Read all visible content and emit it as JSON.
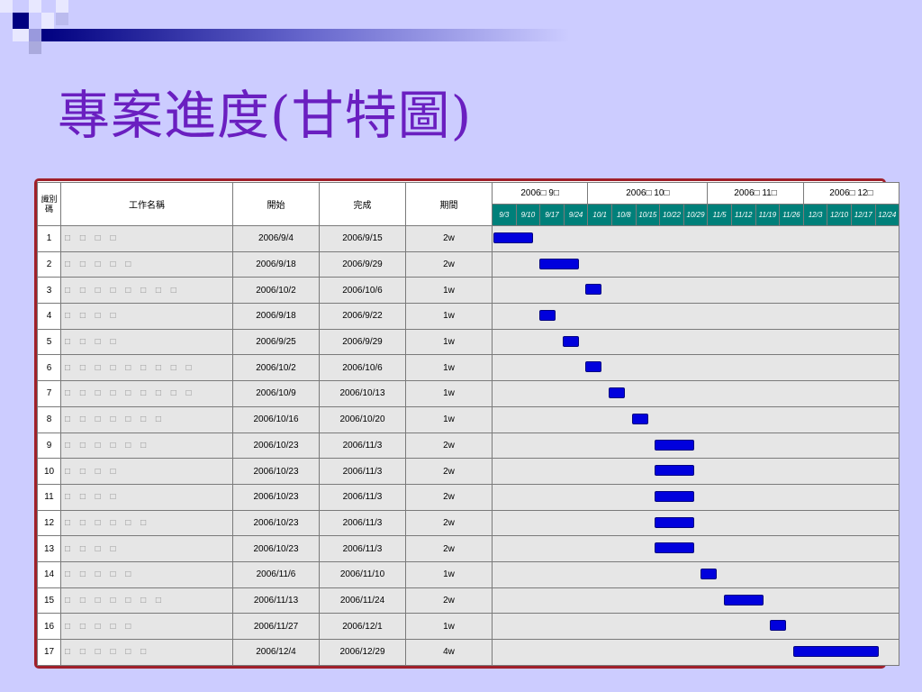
{
  "slide": {
    "title": "專案進度(甘特圖)",
    "colors": {
      "background": "#ccccff",
      "title": "#6a1fc0",
      "week_header": "#00807a",
      "bar": "#0000dd",
      "frame": "#a0202a"
    }
  },
  "table": {
    "headers": {
      "id": "識別碼",
      "name": "工作名稱",
      "start": "開始",
      "finish": "完成",
      "duration": "期間"
    },
    "months": [
      {
        "label": "2006□ 9□",
        "weeks": 4
      },
      {
        "label": "2006□ 10□",
        "weeks": 5
      },
      {
        "label": "2006□ 11□",
        "weeks": 4
      },
      {
        "label": "2006□ 12□",
        "weeks": 4
      }
    ],
    "weeks": [
      "9/3",
      "9/10",
      "9/17",
      "9/24",
      "10/1",
      "10/8",
      "10/15",
      "10/22",
      "10/29",
      "11/5",
      "11/12",
      "11/19",
      "11/26",
      "12/3",
      "12/10",
      "12/17",
      "12/24"
    ],
    "rows": [
      {
        "id": "1",
        "name": "□ □ □ □",
        "start": "2006/9/4",
        "finish": "2006/9/15",
        "duration": "2w",
        "bar_start_week": 0,
        "bar_weeks": 1.7
      },
      {
        "id": "2",
        "name": "□ □ □ □ □",
        "start": "2006/9/18",
        "finish": "2006/9/29",
        "duration": "2w",
        "bar_start_week": 2,
        "bar_weeks": 1.7
      },
      {
        "id": "3",
        "name": "□ □ □ □ □ □ □ □",
        "start": "2006/10/2",
        "finish": "2006/10/6",
        "duration": "1w",
        "bar_start_week": 4,
        "bar_weeks": 0.7
      },
      {
        "id": "4",
        "name": "□ □ □ □",
        "start": "2006/9/18",
        "finish": "2006/9/22",
        "duration": "1w",
        "bar_start_week": 2,
        "bar_weeks": 0.7
      },
      {
        "id": "5",
        "name": "□ □ □ □",
        "start": "2006/9/25",
        "finish": "2006/9/29",
        "duration": "1w",
        "bar_start_week": 3,
        "bar_weeks": 0.7
      },
      {
        "id": "6",
        "name": "□ □ □ □ □ □ □ □ □",
        "start": "2006/10/2",
        "finish": "2006/10/6",
        "duration": "1w",
        "bar_start_week": 4,
        "bar_weeks": 0.7
      },
      {
        "id": "7",
        "name": "□ □ □ □ □ □ □ □ □",
        "start": "2006/10/9",
        "finish": "2006/10/13",
        "duration": "1w",
        "bar_start_week": 5,
        "bar_weeks": 0.7
      },
      {
        "id": "8",
        "name": "□ □ □ □ □ □ □",
        "start": "2006/10/16",
        "finish": "2006/10/20",
        "duration": "1w",
        "bar_start_week": 6,
        "bar_weeks": 0.7
      },
      {
        "id": "9",
        "name": "□ □ □ □ □ □",
        "start": "2006/10/23",
        "finish": "2006/11/3",
        "duration": "2w",
        "bar_start_week": 7,
        "bar_weeks": 1.7
      },
      {
        "id": "10",
        "name": "□ □ □ □",
        "start": "2006/10/23",
        "finish": "2006/11/3",
        "duration": "2w",
        "bar_start_week": 7,
        "bar_weeks": 1.7
      },
      {
        "id": "11",
        "name": "□ □ □ □",
        "start": "2006/10/23",
        "finish": "2006/11/3",
        "duration": "2w",
        "bar_start_week": 7,
        "bar_weeks": 1.7
      },
      {
        "id": "12",
        "name": "□ □ □ □ □ □",
        "start": "2006/10/23",
        "finish": "2006/11/3",
        "duration": "2w",
        "bar_start_week": 7,
        "bar_weeks": 1.7
      },
      {
        "id": "13",
        "name": "□ □ □ □",
        "start": "2006/10/23",
        "finish": "2006/11/3",
        "duration": "2w",
        "bar_start_week": 7,
        "bar_weeks": 1.7
      },
      {
        "id": "14",
        "name": "□ □ □ □ □",
        "start": "2006/11/6",
        "finish": "2006/11/10",
        "duration": "1w",
        "bar_start_week": 9,
        "bar_weeks": 0.7
      },
      {
        "id": "15",
        "name": "□ □ □ □ □ □ □",
        "start": "2006/11/13",
        "finish": "2006/11/24",
        "duration": "2w",
        "bar_start_week": 10,
        "bar_weeks": 1.7
      },
      {
        "id": "16",
        "name": "□ □ □ □ □",
        "start": "2006/11/27",
        "finish": "2006/12/1",
        "duration": "1w",
        "bar_start_week": 12,
        "bar_weeks": 0.7
      },
      {
        "id": "17",
        "name": "□ □ □ □ □ □",
        "start": "2006/12/4",
        "finish": "2006/12/29",
        "duration": "4w",
        "bar_start_week": 13,
        "bar_weeks": 3.7
      }
    ]
  }
}
